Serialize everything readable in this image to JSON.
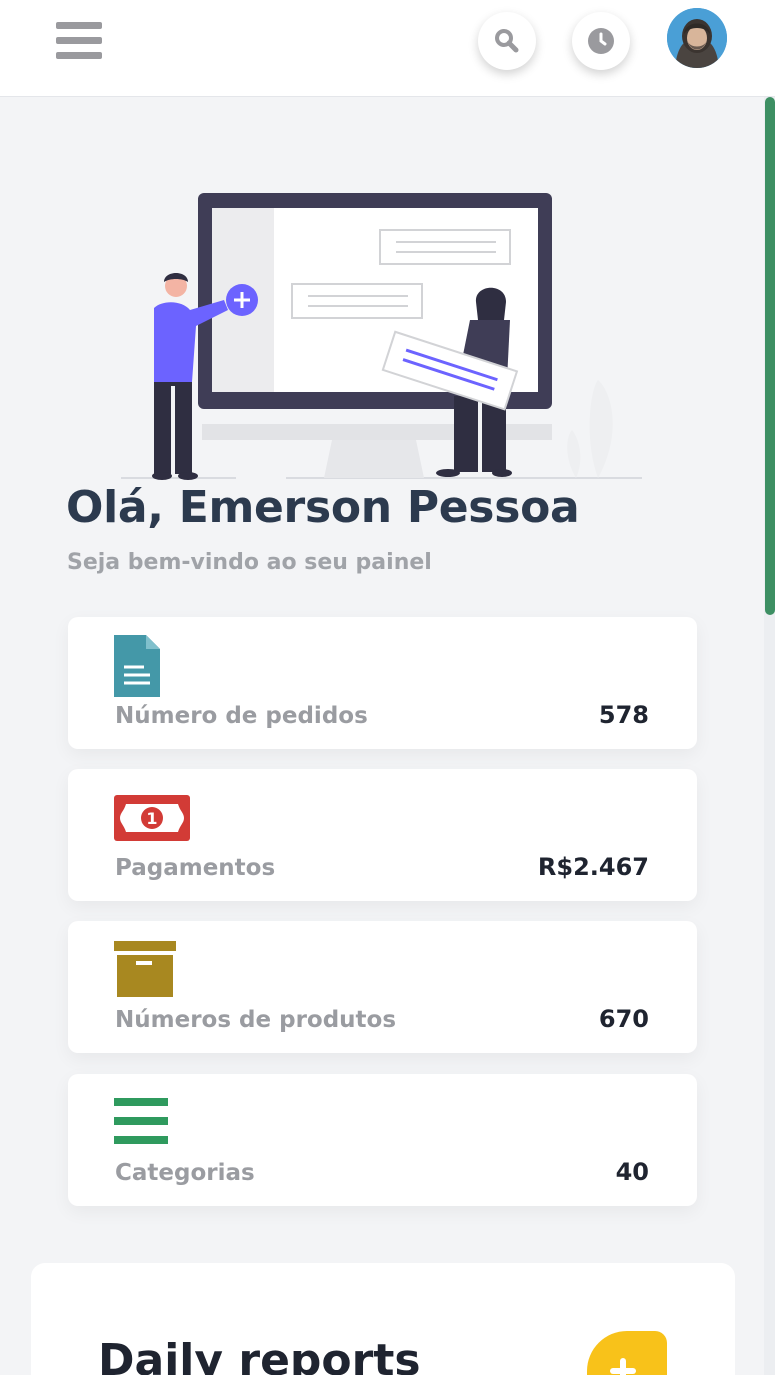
{
  "header": {
    "menu_icon": "hamburger-menu-icon",
    "search_icon": "search-icon",
    "history_icon": "clock-icon",
    "avatar": "user-avatar"
  },
  "hero": {
    "illustration": "people-with-monitor-illustration",
    "greeting": "Olá, Emerson Pessoa",
    "subtitle": "Seja bem-vindo ao seu painel"
  },
  "stats": [
    {
      "icon": "document-icon",
      "label": "Número de pedidos",
      "value": "578",
      "color": "#4498a8"
    },
    {
      "icon": "banknote-icon",
      "label": "Pagamentos",
      "value": "R$2.467",
      "color": "#d23b36"
    },
    {
      "icon": "archive-box-icon",
      "label": "Números de produtos",
      "value": "670",
      "color": "#a88820"
    },
    {
      "icon": "list-icon",
      "label": "Categorias",
      "value": "40",
      "color": "#2f9a5e"
    }
  ],
  "reports": {
    "title": "Daily reports",
    "action_icon": "add-icon"
  },
  "colors": {
    "accent": "#6c63ff",
    "scrollbar": "#3d8f63",
    "reports_button": "#f8c21a",
    "heading": "#2c3a4e"
  }
}
